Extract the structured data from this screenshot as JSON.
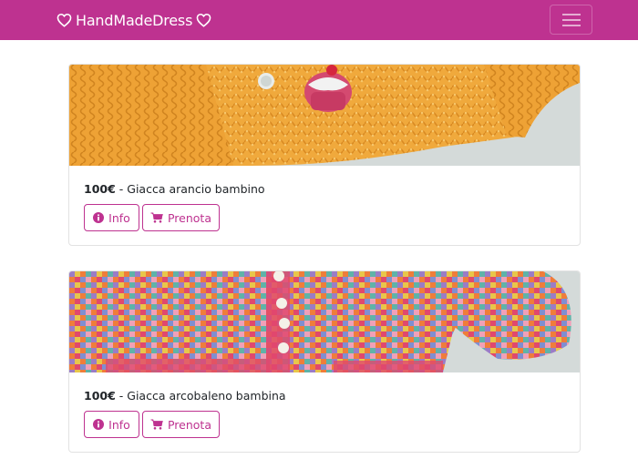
{
  "navbar": {
    "brand": "HandMadeDress",
    "brand_icon": "heart-outline-icon",
    "toggler_icon": "hamburger-icon",
    "color": "#be3290"
  },
  "products": [
    {
      "price": "100€",
      "separator": " - ",
      "name": "Giacca arancio bambino",
      "info_label": "Info",
      "book_label": "Prenota",
      "image_description_colors": [
        "#f0a93c",
        "#d4dad9"
      ]
    },
    {
      "price": "100€",
      "separator": " - ",
      "name": "Giacca arcobaleno bambina",
      "info_label": "Info",
      "book_label": "Prenota",
      "image_description_colors": [
        "#e0486e",
        "#9b7cc6",
        "#e8c64a"
      ]
    }
  ],
  "icons": {
    "info": "info-circle-icon",
    "cart": "shopping-cart-icon"
  }
}
